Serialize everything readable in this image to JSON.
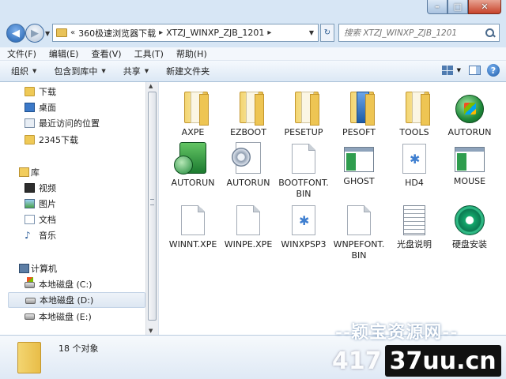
{
  "window": {
    "caption_buttons": {
      "minimize": "–",
      "maximize": "□",
      "close": "✕"
    }
  },
  "address_bar": {
    "overflow": "«",
    "crumbs": [
      "360极速浏览器下载",
      "XTZJ_WINXP_ZJB_1201"
    ]
  },
  "search": {
    "placeholder": "搜索 XTZJ_WINXP_ZJB_1201"
  },
  "menu": [
    "文件(F)",
    "编辑(E)",
    "查看(V)",
    "工具(T)",
    "帮助(H)"
  ],
  "commands": [
    "组织",
    "包含到库中",
    "共享",
    "新建文件夹"
  ],
  "nav_pane": {
    "favorites": [
      "下载",
      "桌面",
      "最近访问的位置",
      "2345下载"
    ],
    "libraries_header": "库",
    "libraries": [
      "视频",
      "图片",
      "文档",
      "音乐"
    ],
    "computer_header": "计算机",
    "drives": [
      "本地磁盘 (C:)",
      "本地磁盘 (D:)",
      "本地磁盘 (E:)"
    ]
  },
  "files": [
    {
      "name": "AXPE",
      "icon": "folder-icon"
    },
    {
      "name": "EZBOOT",
      "icon": "folder-icon"
    },
    {
      "name": "PESETUP",
      "icon": "folder-icon"
    },
    {
      "name": "PESOFT",
      "icon": "folder-icon"
    },
    {
      "name": "TOOLS",
      "icon": "folder-icon"
    },
    {
      "name": "AUTORUN",
      "icon": "autorun-exe-icon"
    },
    {
      "name": "AUTORUN",
      "icon": "autorun-app-icon"
    },
    {
      "name": "AUTORUN",
      "icon": "autorun-ini-icon"
    },
    {
      "name": "BOOTFONT.BIN",
      "icon": "file-icon"
    },
    {
      "name": "GHOST",
      "icon": "window-icon"
    },
    {
      "name": "HD4",
      "icon": "setup-file-icon"
    },
    {
      "name": "MOUSE",
      "icon": "window-icon"
    },
    {
      "name": "WINNT.XPE",
      "icon": "file-icon"
    },
    {
      "name": "WINPE.XPE",
      "icon": "file-icon"
    },
    {
      "name": "WINXPSP3",
      "icon": "setup-file-icon"
    },
    {
      "name": "WNPEFONT.BIN",
      "icon": "file-icon"
    },
    {
      "name": "光盘说明",
      "icon": "text-file-icon"
    },
    {
      "name": "硬盘安装",
      "icon": "installer-disc-icon"
    }
  ],
  "details": {
    "count": "18 个对象"
  },
  "watermark": {
    "line": "--颖宝资源网--",
    "number": "417",
    "site": "37uu.cn"
  }
}
